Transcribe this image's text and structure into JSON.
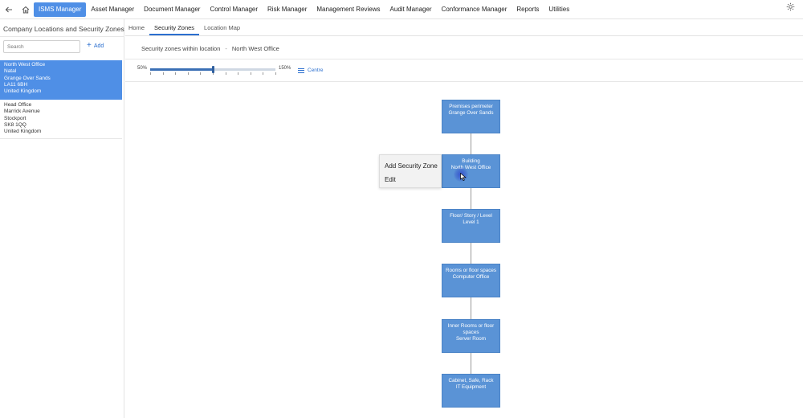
{
  "nav": {
    "back_icon": "arrow-left-icon",
    "home_icon": "home-icon",
    "items": [
      {
        "label": "ISMS Manager",
        "active": true
      },
      {
        "label": "Asset Manager",
        "active": false
      },
      {
        "label": "Document Manager",
        "active": false
      },
      {
        "label": "Control Manager",
        "active": false
      },
      {
        "label": "Risk Manager",
        "active": false
      },
      {
        "label": "Management Reviews",
        "active": false
      },
      {
        "label": "Audit Manager",
        "active": false
      },
      {
        "label": "Conformance Manager",
        "active": false
      },
      {
        "label": "Reports",
        "active": false
      },
      {
        "label": "Utilities",
        "active": false
      }
    ],
    "settings_icon": "gear-icon",
    "active_color": "#4f8fe6"
  },
  "sidebar": {
    "title": "Company Locations and Security Zones",
    "search_placeholder": "Search",
    "add_label": "Add",
    "locations": [
      {
        "lines": [
          "North West Office",
          "Natal",
          "Grange Over Sands",
          "LA11 6BH",
          "United Kingdom"
        ],
        "selected": true
      },
      {
        "lines": [
          "Head Office",
          "Marrick Avenue",
          "Stockport",
          "SK8 1QQ",
          "United Kingdom"
        ],
        "selected": false
      }
    ]
  },
  "tabs": [
    {
      "label": "Home",
      "active": false
    },
    {
      "label": "Security Zones",
      "active": true
    },
    {
      "label": "Location Map",
      "active": false
    }
  ],
  "breadcrumb": {
    "prefix": "Security zones within location",
    "separator": "-",
    "location": "North West Office"
  },
  "zoom": {
    "min_label": "50%",
    "max_label": "150%",
    "value_fraction": 0.5,
    "centre_label": "Centre"
  },
  "zones": [
    {
      "type": "Premises perimeter",
      "name": "Grange Over Sands"
    },
    {
      "type": "Building",
      "name": "North West Office"
    },
    {
      "type": "Floor/ Story / Level",
      "name": "Level 1"
    },
    {
      "type": "Rooms or floor spaces",
      "name": "Computer Office"
    },
    {
      "type": "Inner Rooms or floor spaces",
      "name": "Server Room"
    },
    {
      "type": "Cabinet, Safe, Rack",
      "name": "IT Equipment"
    }
  ],
  "context_menu": {
    "items": [
      "Add Security Zone",
      "Edit"
    ]
  }
}
